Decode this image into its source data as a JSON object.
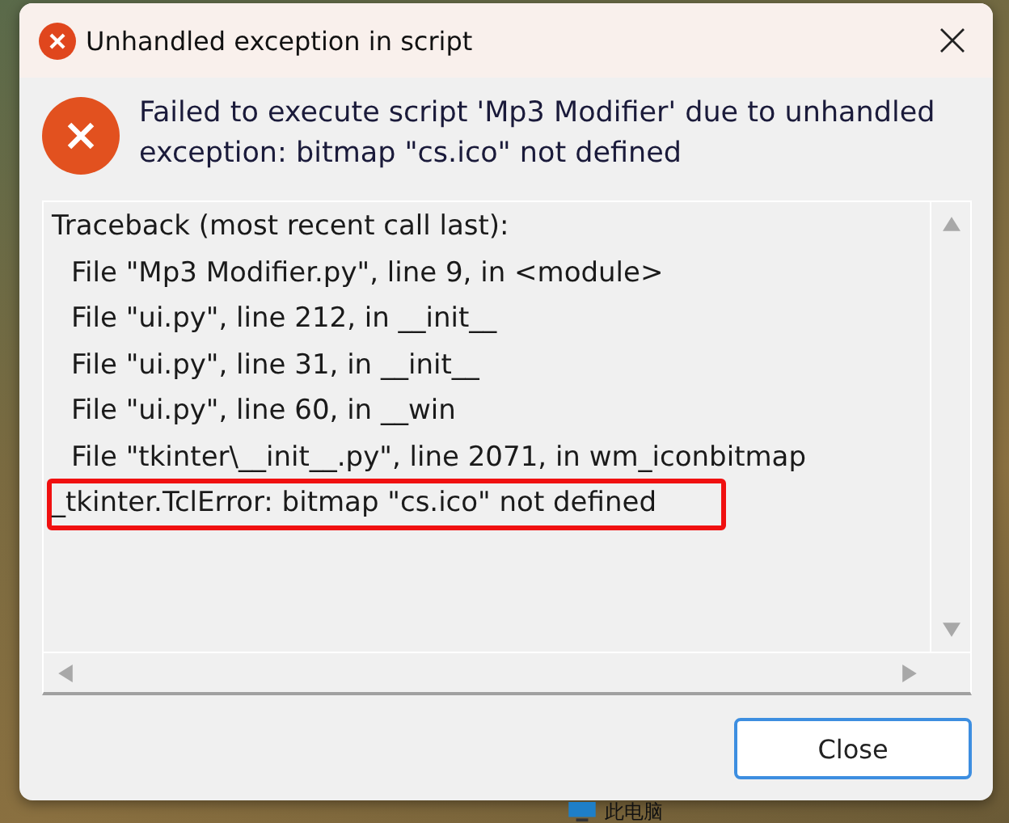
{
  "window": {
    "title": "Unhandled exception in script"
  },
  "message": "Failed to execute script 'Mp3 Modifier' due to unhandled exception: bitmap \"cs.ico\" not defined",
  "traceback": {
    "lines": [
      {
        "text": "Traceback (most recent call last):",
        "indented": false,
        "highlighted": false
      },
      {
        "text": "File \"Mp3 Modifier.py\", line 9, in <module>",
        "indented": true,
        "highlighted": false
      },
      {
        "text": "File \"ui.py\", line 212, in __init__",
        "indented": true,
        "highlighted": false
      },
      {
        "text": "File \"ui.py\", line 31, in __init__",
        "indented": true,
        "highlighted": false
      },
      {
        "text": "File \"ui.py\", line 60, in __win",
        "indented": true,
        "highlighted": false
      },
      {
        "text": "File \"tkinter\\__init__.py\", line 2071, in wm_iconbitmap",
        "indented": true,
        "highlighted": false
      },
      {
        "text": "_tkinter.TclError: bitmap \"cs.ico\" not defined",
        "indented": false,
        "highlighted": true
      }
    ]
  },
  "buttons": [
    {
      "label": "Close",
      "selected": true
    }
  ],
  "desktop": {
    "icon_label": "此电脑"
  }
}
